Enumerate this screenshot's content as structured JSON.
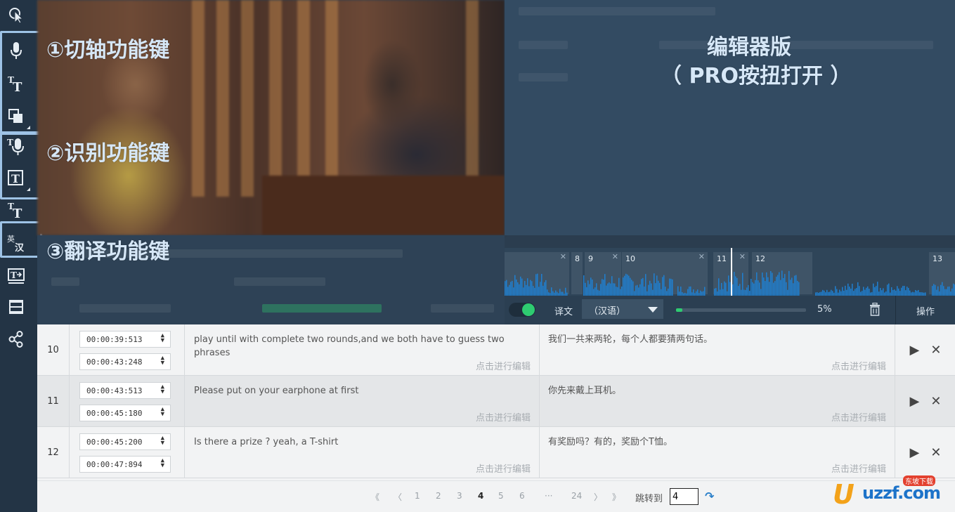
{
  "annotations": {
    "group1": "①切轴功能键",
    "group2": "②识别功能键",
    "group3": "③翻译功能键",
    "editor_line1": "编辑器版",
    "editor_line2": "（ PRO按扭打开 ）"
  },
  "toolbar": {
    "translate_tool_label_top": "英",
    "translate_tool_label_bottom": "汉",
    "text_tool_glyph": "T"
  },
  "timeline": {
    "segments": [
      "8",
      "9",
      "10",
      "11",
      "12",
      "13"
    ],
    "close_glyph": "✕"
  },
  "translate_bar": {
    "label": "译文",
    "language": "（汉语）",
    "progress_percent": 5,
    "progress_text": "5%",
    "operations_label": "操作"
  },
  "rows": [
    {
      "index": "10",
      "start": "00:00:39:513",
      "end": "00:00:43:248",
      "source": "play until with complete two rounds,and we both have to guess two phrases",
      "translation": "我们一共来两轮，每个人都要猜两句话。",
      "edit_hint": "点击进行编辑"
    },
    {
      "index": "11",
      "start": "00:00:43:513",
      "end": "00:00:45:180",
      "source": "Please put on your earphone at first",
      "translation": "你先来戴上耳机。",
      "edit_hint": "点击进行编辑"
    },
    {
      "index": "12",
      "start": "00:00:45:200",
      "end": "00:00:47:894",
      "source": "Is there a prize ? yeah, a T-shirt",
      "translation": "有奖励吗？有的，奖励个T恤。",
      "edit_hint": "点击进行编辑"
    }
  ],
  "row_actions": {
    "play": "▶",
    "delete": "✕"
  },
  "pager": {
    "first": "《",
    "prev": "〈",
    "pages": [
      "1",
      "2",
      "3",
      "4",
      "5",
      "6",
      "···",
      "24"
    ],
    "current": "4",
    "next": "〉",
    "last": "》",
    "jump_label": "跳转到",
    "jump_value": "4",
    "go": "↷"
  },
  "watermark": {
    "mark": "U",
    "word": "uzzf.com",
    "tag": "东坡下载"
  },
  "colors": {
    "accent_green": "#2ecc71",
    "annotation": "#d6e7f7",
    "toolbar_bg": "#233445",
    "panel_bg": "#334b62",
    "wave": "#1f7fd0"
  }
}
